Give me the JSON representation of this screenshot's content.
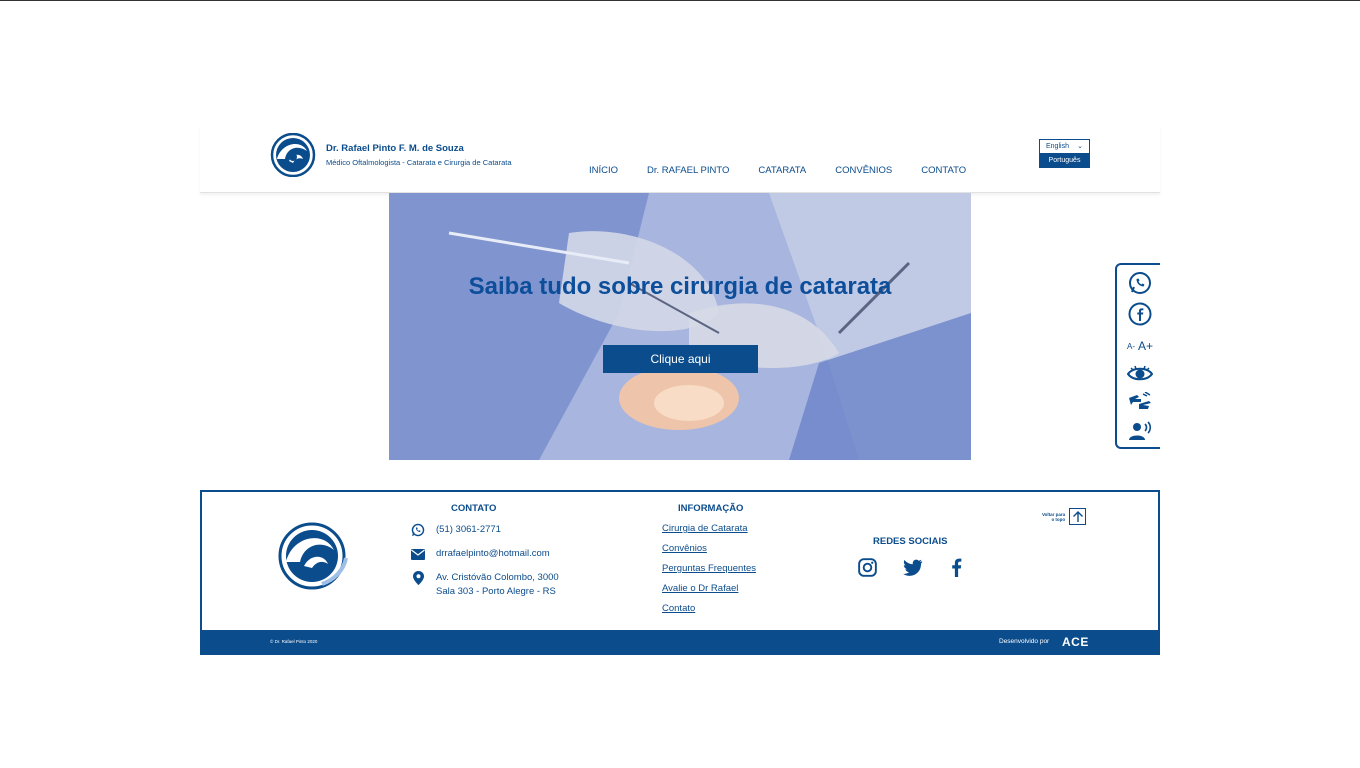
{
  "header": {
    "name": "Dr. Rafael Pinto F. M. de Souza",
    "subtitle": "Médico Oftalmologista - Catarata e Cirurgia de Catarata",
    "nav": [
      "INÍCIO",
      "Dr. RAFAEL PINTO",
      "CATARATA",
      "CONVÊNIOS",
      "CONTATO"
    ],
    "language": {
      "selected": "English",
      "option": "Português"
    }
  },
  "hero": {
    "title": "Saiba tudo sobre cirurgia de catarata",
    "button": "Clique aqui"
  },
  "accessibility": {
    "icons": [
      "whatsapp-icon",
      "facebook-icon",
      "font-size-icon",
      "contrast-eye-icon",
      "sign-language-icon",
      "screen-reader-icon"
    ],
    "font_size_small": "A-",
    "font_size_large": "A+"
  },
  "footer": {
    "contact_title": "CONTATO",
    "phone": "(51) 3061-2771",
    "email": "drrafaelpinto@hotmail.com",
    "address_line1": "Av. Cristóvão Colombo, 3000",
    "address_line2": "Sala 303 - Porto Alegre - RS",
    "info_title": "INFORMAÇÃO",
    "info_links": [
      "Cirurgia de Catarata",
      "Convênios",
      "Perguntas Frequentes",
      "Avalie o Dr Rafael",
      "Contato"
    ],
    "social_title": "REDES SOCIAIS",
    "social_icons": [
      "instagram-icon",
      "twitter-icon",
      "facebook-icon"
    ],
    "back_to_top_line1": "Voltar para",
    "back_to_top_line2": "o topo",
    "copyright": "© Dr. Rafael Pinto 2020",
    "developed_by": "Desenvolvido por",
    "developer": "ACE"
  },
  "colors": {
    "brand": "#0b4c8c",
    "hero_title": "#0d4e9a"
  }
}
